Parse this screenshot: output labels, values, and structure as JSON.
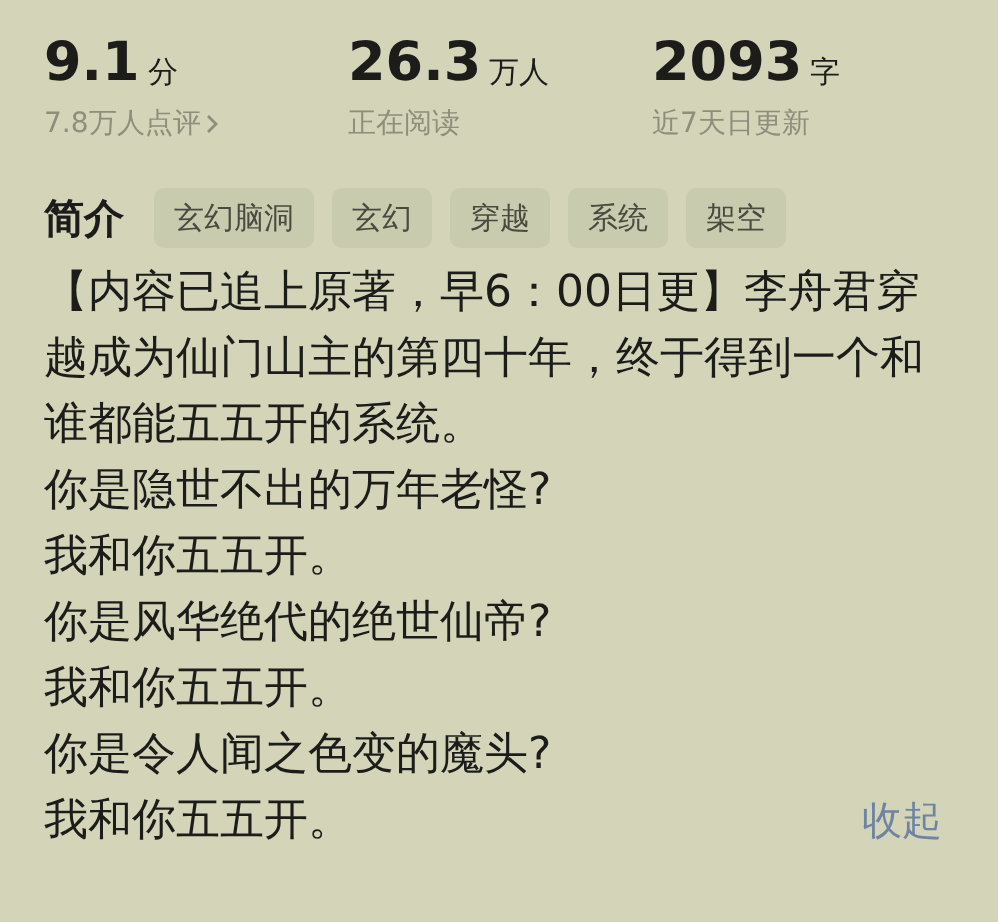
{
  "stats": [
    {
      "value": "9.1",
      "unit": "分",
      "caption": "7.8万人点评",
      "has_arrow": true
    },
    {
      "value": "26.3",
      "unit": "万人",
      "caption": "正在阅读",
      "has_arrow": false
    },
    {
      "value": "2093",
      "unit": "字",
      "caption": "近7天日更新",
      "has_arrow": false
    }
  ],
  "intro": {
    "title": "简介",
    "tags": [
      "玄幻脑洞",
      "玄幻",
      "穿越",
      "系统",
      "架空"
    ],
    "paragraphs": [
      "【内容已追上原著，早6：00日更】李舟君穿越成为仙门山主的第四十年，终于得到一个和谁都能五五开的系统。",
      "你是隐世不出的万年老怪?",
      "我和你五五开。",
      "你是风华绝代的绝世仙帝?",
      "我和你五五开。",
      "你是令人闻之色变的魔头?",
      "我和你五五开。"
    ],
    "collapse_link": "收起"
  }
}
